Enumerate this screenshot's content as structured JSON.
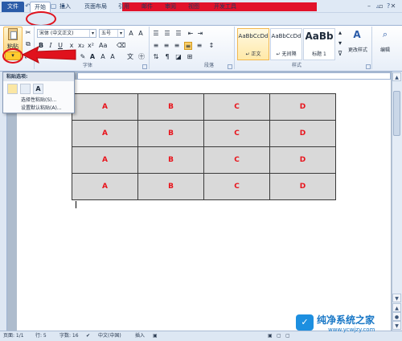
{
  "quick_access": {
    "icons": [
      "word-logo",
      "save-icon",
      "undo-icon",
      "redo-icon",
      "print-preview-icon",
      "dropdown-icon"
    ]
  },
  "tabs": [
    "文件",
    "开始",
    "插入",
    "页面布局",
    "引用",
    "邮件",
    "审阅",
    "视图",
    "开发工具"
  ],
  "ribbon": {
    "paste_label": "粘贴",
    "font_name": "宋体 (中文正文)",
    "font_size": "五号",
    "group_font": "字体",
    "group_paragraph": "段落",
    "group_styles": "样式",
    "styles": [
      {
        "sample": "AaBbCcDd",
        "name": "↵ 正文"
      },
      {
        "sample": "AaBbCcDd",
        "name": "↵ 无间隔"
      },
      {
        "sample": "AaBb",
        "name": "标题 1"
      }
    ],
    "change_styles": "更改样式",
    "editing": "编辑"
  },
  "paste_popup": {
    "title": "粘贴选项:",
    "menu": [
      "选择性粘贴(S)...",
      "设置默认粘贴(A)..."
    ]
  },
  "document": {
    "table": [
      [
        "A",
        "B",
        "C",
        "D"
      ],
      [
        "A",
        "B",
        "C",
        "D"
      ],
      [
        "A",
        "B",
        "C",
        "D"
      ],
      [
        "A",
        "B",
        "C",
        "D"
      ]
    ]
  },
  "status": {
    "page": "页面: 1/1",
    "line": "行: 5",
    "words": "字数: 16",
    "lang": "中文(中国)",
    "mode": "插入"
  },
  "watermark": {
    "title": "纯净系统之家",
    "url": "www.ycwjzy.com"
  },
  "colors": {
    "highlight": "#e0121d",
    "table_text": "#e8141c",
    "table_fill": "#d9d9d9"
  }
}
